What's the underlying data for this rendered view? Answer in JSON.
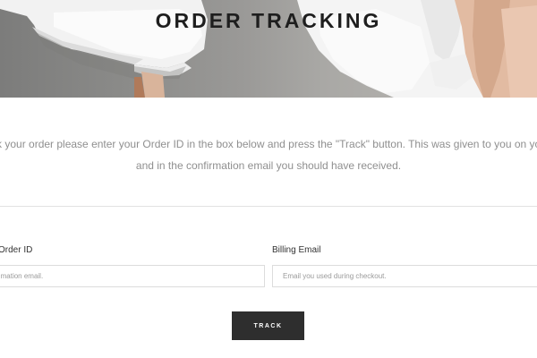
{
  "hero": {
    "title": "ORDER TRACKING"
  },
  "intro": {
    "line1": "To track your order please enter your Order ID in the box below and press the \"Track\" button. This was given to you on your receipt",
    "line2": "and in the confirmation email you should have received."
  },
  "form": {
    "order_id": {
      "label": "Order ID",
      "placeholder": "Found in your order confirmation email.",
      "value": ""
    },
    "billing_email": {
      "label": "Billing Email",
      "placeholder": "Email you used during checkout.",
      "value": ""
    },
    "track_label": "TRACK"
  },
  "colors": {
    "title": "#1e1e1e",
    "body_text": "#8f8f8f",
    "button_bg": "#2e2e2e",
    "button_text": "#ffffff",
    "input_border": "#dcdcdc"
  }
}
